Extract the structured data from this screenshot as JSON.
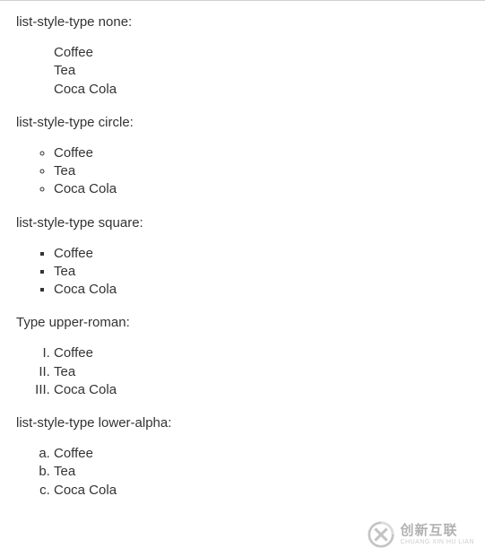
{
  "sections": [
    {
      "label": "list-style-type none:",
      "type": "none",
      "items": [
        "Coffee",
        "Tea",
        "Coca Cola"
      ]
    },
    {
      "label": "list-style-type circle:",
      "type": "circle",
      "items": [
        "Coffee",
        "Tea",
        "Coca Cola"
      ]
    },
    {
      "label": "list-style-type square:",
      "type": "square",
      "items": [
        "Coffee",
        "Tea",
        "Coca Cola"
      ]
    },
    {
      "label": "Type upper-roman:",
      "type": "upper-roman",
      "items": [
        "Coffee",
        "Tea",
        "Coca Cola"
      ]
    },
    {
      "label": "list-style-type lower-alpha:",
      "type": "lower-alpha",
      "items": [
        "Coffee",
        "Tea",
        "Coca Cola"
      ]
    }
  ],
  "watermark": {
    "cn": "创新互联",
    "en": "CHUANG XIN HU LIAN"
  }
}
